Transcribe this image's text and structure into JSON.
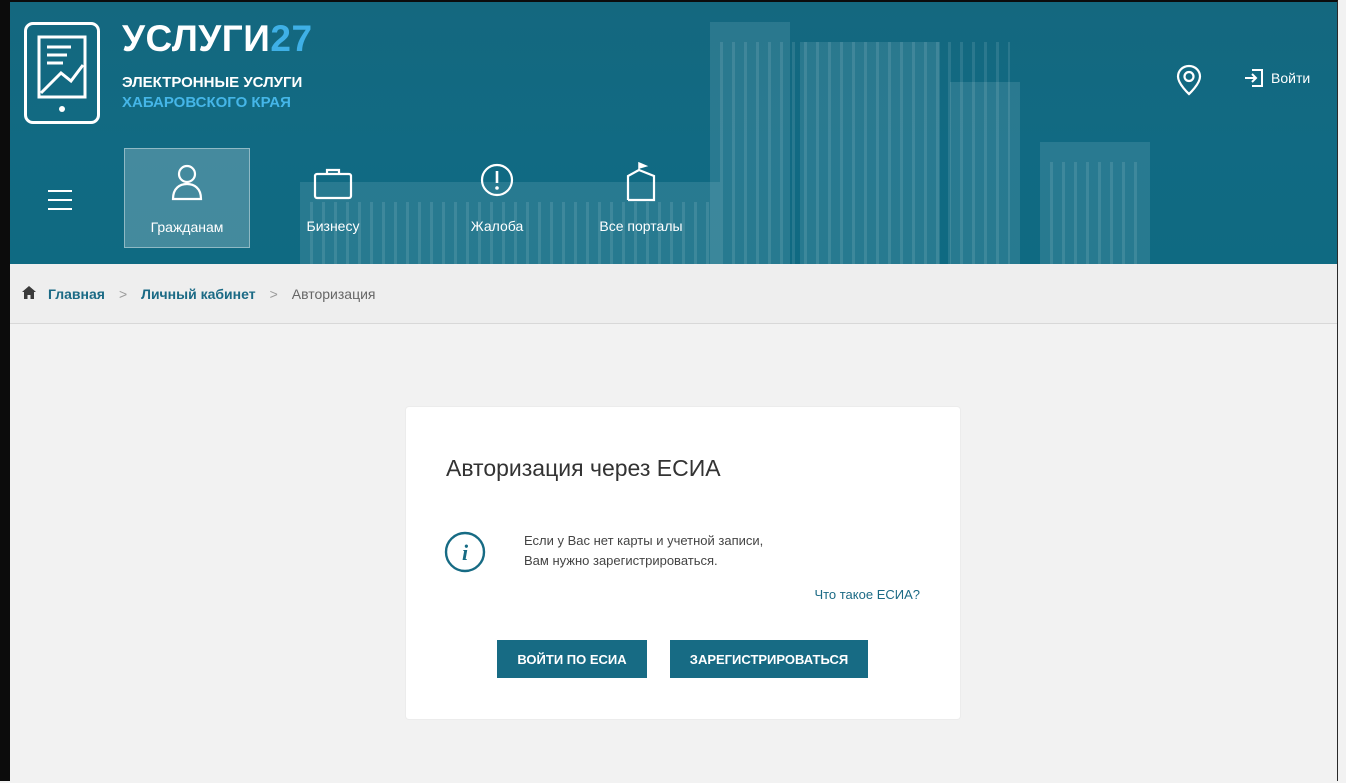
{
  "brand": {
    "title_main": "УСЛУГИ",
    "title_num": "27",
    "subtitle_1": "ЭЛЕКТРОННЫЕ УСЛУГИ",
    "subtitle_2": "ХАБАРОВСКОГО КРАЯ"
  },
  "header": {
    "login_label": "Войти"
  },
  "nav": {
    "items": [
      {
        "label": "Гражданам",
        "icon": "person-icon",
        "active": true
      },
      {
        "label": "Бизнесу",
        "icon": "briefcase-icon",
        "active": false
      },
      {
        "label": "Жалоба",
        "icon": "exclamation-circle-icon",
        "active": false
      },
      {
        "label": "Все порталы",
        "icon": "portals-icon",
        "active": false
      }
    ]
  },
  "breadcrumb": {
    "home": "Главная",
    "cabinet": "Личный кабинет",
    "current": "Авторизация"
  },
  "card": {
    "title": "Авторизация через ЕСИА",
    "info_line1": "Если у Вас нет карты и учетной записи,",
    "info_line2": "Вам нужно зарегистрироваться.",
    "what_link": "Что такое ЕСИА?",
    "btn_esia": "ВОЙТИ ПО ЕСИА",
    "btn_register": "ЗАРЕГИСТРИРОВАТЬСЯ"
  },
  "colors": {
    "header_bg": "#116a83",
    "accent_blue": "#3fb0e6",
    "button_bg": "#176b84",
    "link": "#1b6a85",
    "page_bg": "#f2f2f2"
  }
}
